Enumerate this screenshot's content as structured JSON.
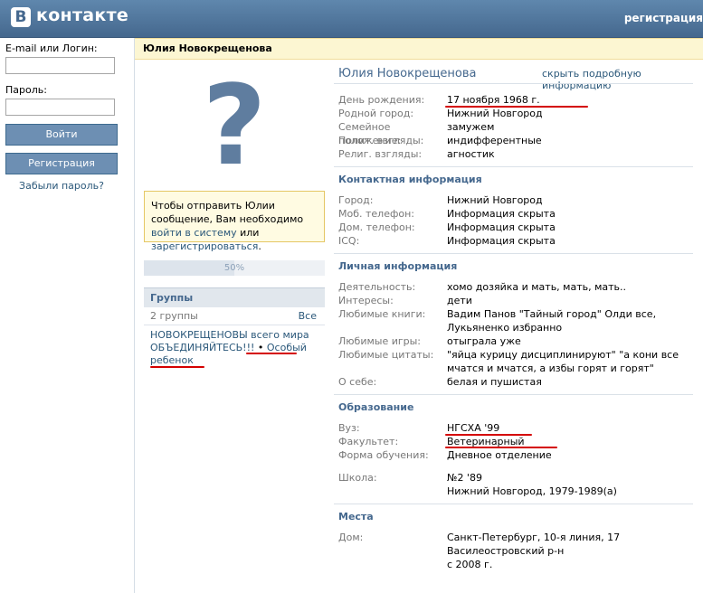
{
  "header": {
    "logo_badge": "В",
    "logo_text": "контакте",
    "register_link": "регистрация"
  },
  "login": {
    "email_label": "E-mail или Логин:",
    "email_value": "",
    "password_label": "Пароль:",
    "password_value": "",
    "login_button": "Войти",
    "register_button": "Регистрация",
    "forgot_link": "Забыли пароль?"
  },
  "profile": {
    "title_bar": "Юлия Новокрещенова",
    "name": "Юлия Новокрещенова",
    "hide_link": "скрыть подробную информацию",
    "avatar_placeholder": "?"
  },
  "message_box": {
    "text_before": "Чтобы отправить Юлии сообщение, Вам необходимо ",
    "login_link": "войти в систему",
    "or_text": " или ",
    "register_link": "зарегистрироваться",
    "end": "."
  },
  "progress": {
    "label": "50%",
    "value": 0.5
  },
  "groups": {
    "title": "Группы",
    "count": "2 группы",
    "all_link": "Все",
    "items": [
      "НОВОКРЕЩЕНОВЫ всего мира ОБЪЕДИНЯЙТЕСЬ!!!",
      "Особый ребенок"
    ],
    "separator": " • "
  },
  "basic_info": [
    {
      "label": "День рождения:",
      "value": "17 ноября 1968 г."
    },
    {
      "label": "Родной город:",
      "value": "Нижний Новгород"
    },
    {
      "label": "Семейное положение:",
      "value": "замужем"
    },
    {
      "label": "Полит. взгляды:",
      "value": "индифферентные"
    },
    {
      "label": "Религ. взгляды:",
      "value": "агностик"
    }
  ],
  "contact": {
    "title": "Контактная информация",
    "rows": [
      {
        "label": "Город:",
        "value": "Нижний Новгород"
      },
      {
        "label": "Моб. телефон:",
        "value": "Информация скрыта"
      },
      {
        "label": "Дом. телефон:",
        "value": "Информация скрыта"
      },
      {
        "label": "ICQ:",
        "value": "Информация скрыта"
      }
    ]
  },
  "personal": {
    "title": "Личная информация",
    "rows": [
      {
        "label": "Деятельность:",
        "value": "хомо дозяйка и мать, мать, мать.."
      },
      {
        "label": "Интересы:",
        "value": "дети"
      },
      {
        "label": "Любимые книги:",
        "value": "Вадим Панов \"Тайный город\" Олди все, Лукьяненко избранно"
      },
      {
        "label": "Любимые игры:",
        "value": "отыграла уже"
      },
      {
        "label": "Любимые цитаты:",
        "value": "\"яйца курицу дисциплинируют\" \"а кони все мчатся и мчатся, а избы горят и горят\""
      },
      {
        "label": "О себе:",
        "value": "белая и пушистая"
      }
    ]
  },
  "education": {
    "title": "Образование",
    "rows": [
      {
        "label": "Вуз:",
        "value": "НГСХА '99"
      },
      {
        "label": "Факультет:",
        "value": "Ветеринарный"
      },
      {
        "label": "Форма обучения:",
        "value": "Дневное отделение"
      }
    ],
    "school_label": "Школа:",
    "school_value": "№2 '89",
    "school_value2": "Нижний Новгород, 1979-1989(а)"
  },
  "places": {
    "title": "Места",
    "label": "Дом:",
    "line1": "Санкт-Петербург, 10-я линия, 17",
    "line2": "Василеостровский р-н",
    "line3": "с 2008 г."
  }
}
